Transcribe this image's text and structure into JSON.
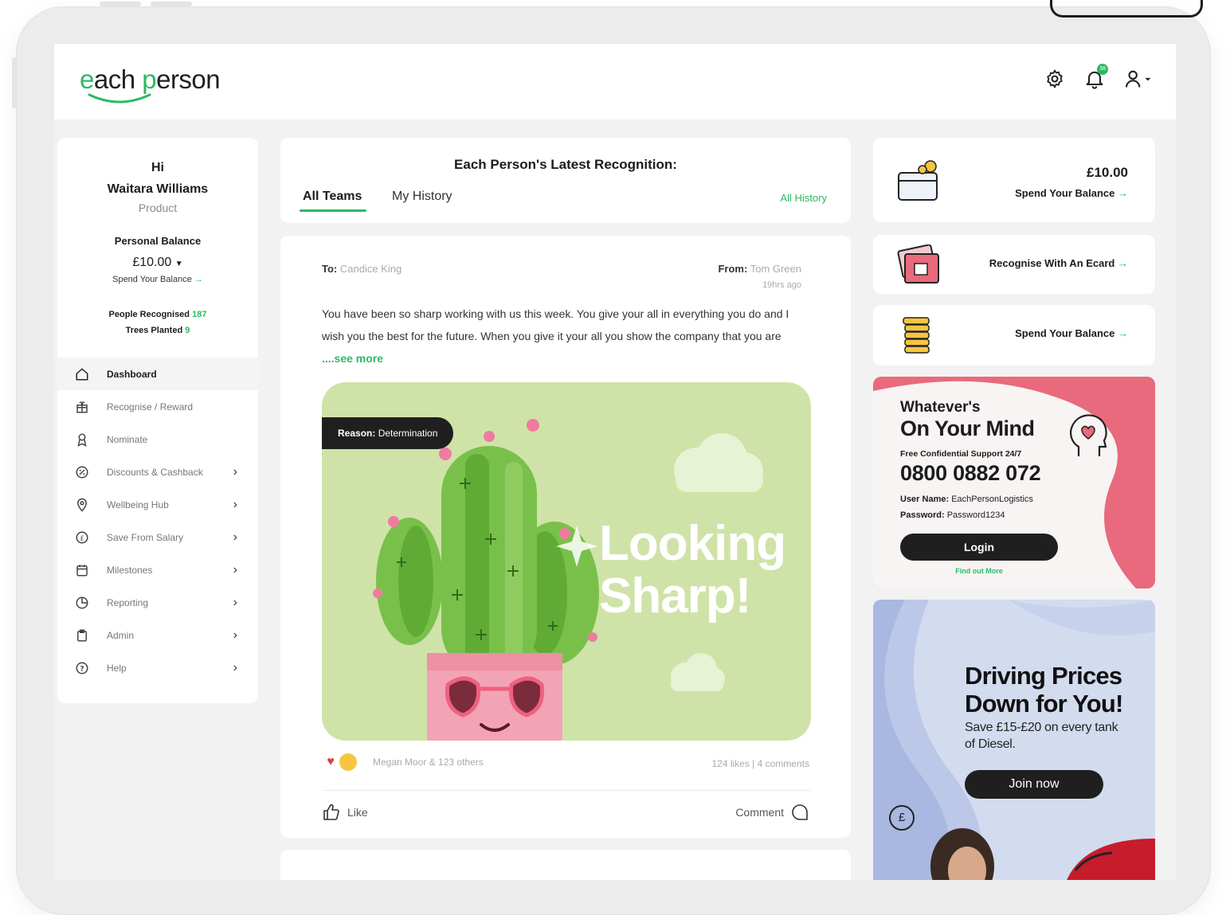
{
  "header": {
    "logo_prefix": "e",
    "logo_mid": "ach ",
    "logo_p": "p",
    "logo_rest": "erson",
    "notification_count": "38"
  },
  "profile": {
    "greeting": "Hi",
    "name": "Waitara Williams",
    "department": "Product",
    "balance_title": "Personal Balance",
    "balance_amount": "£10.00",
    "spend_link": "Spend Your Balance",
    "people_recognised_label": "People Recognised",
    "people_recognised_value": "187",
    "trees_planted_label": "Trees Planted",
    "trees_planted_value": "9"
  },
  "nav": [
    {
      "label": "Dashboard",
      "icon": "home-icon",
      "chevron": false,
      "active": true
    },
    {
      "label": "Recognise / Reward",
      "icon": "gift-icon",
      "chevron": false
    },
    {
      "label": "Nominate",
      "icon": "award-icon",
      "chevron": false
    },
    {
      "label": "Discounts & Cashback",
      "icon": "discount-icon",
      "chevron": true
    },
    {
      "label": "Wellbeing Hub",
      "icon": "location-icon",
      "chevron": true
    },
    {
      "label": "Save From Salary",
      "icon": "pound-icon",
      "chevron": true
    },
    {
      "label": "Milestones",
      "icon": "calendar-icon",
      "chevron": true
    },
    {
      "label": "Reporting",
      "icon": "pie-chart-icon",
      "chevron": true
    },
    {
      "label": "Admin",
      "icon": "clipboard-icon",
      "chevron": true
    },
    {
      "label": "Help",
      "icon": "help-icon",
      "chevron": true
    }
  ],
  "feed": {
    "title": "Each Person's Latest Recognition:",
    "tab_all_teams": "All Teams",
    "tab_my_history": "My History",
    "all_history": "All History"
  },
  "post": {
    "to_label": "To:",
    "to_name": "Candice King",
    "from_label": "From:",
    "from_name": "Tom Green",
    "time": "19hrs ago",
    "message": "You have been so sharp working with us this week. You give your all in everything you do and I wish you the best for the future. When you give it your all you show the company that you are ",
    "see_more": "....see more",
    "reason_label": "Reason:",
    "reason_value": "Determination",
    "ecard_line1": "Looking",
    "ecard_line2": "Sharp!",
    "reaction_names": "Megan Moor & 123 others",
    "reaction_counts": "124 likes | 4 comments",
    "like_label": "Like",
    "comment_label": "Comment"
  },
  "right": {
    "balance_amount": "£10.00",
    "spend_balance": "Spend Your Balance",
    "recognise_ecard": "Recognise With An Ecard",
    "spend_balance_2": "Spend Your Balance",
    "arrow": "→"
  },
  "wellbeing": {
    "line1": "Whatever's",
    "line2": "On Your Mind",
    "support": "Free Confidential Support 24/7",
    "phone": "0800 0882 072",
    "user_label": "User Name:",
    "user_value": "EachPersonLogistics",
    "pass_label": "Password:",
    "pass_value": "Password1234",
    "login": "Login",
    "find_out": "Find out More"
  },
  "promo": {
    "title_line1": "Driving Prices",
    "title_line2": "Down for You!",
    "subtitle": "Save £15-£20 on every tank of Diesel.",
    "join": "Join now",
    "coin": "£"
  },
  "colors": {
    "accent": "#2db865",
    "wellbeing_pink": "#e86a7c",
    "promo_blue": "#d3dbef",
    "ecard_green": "#cfe3a8"
  }
}
